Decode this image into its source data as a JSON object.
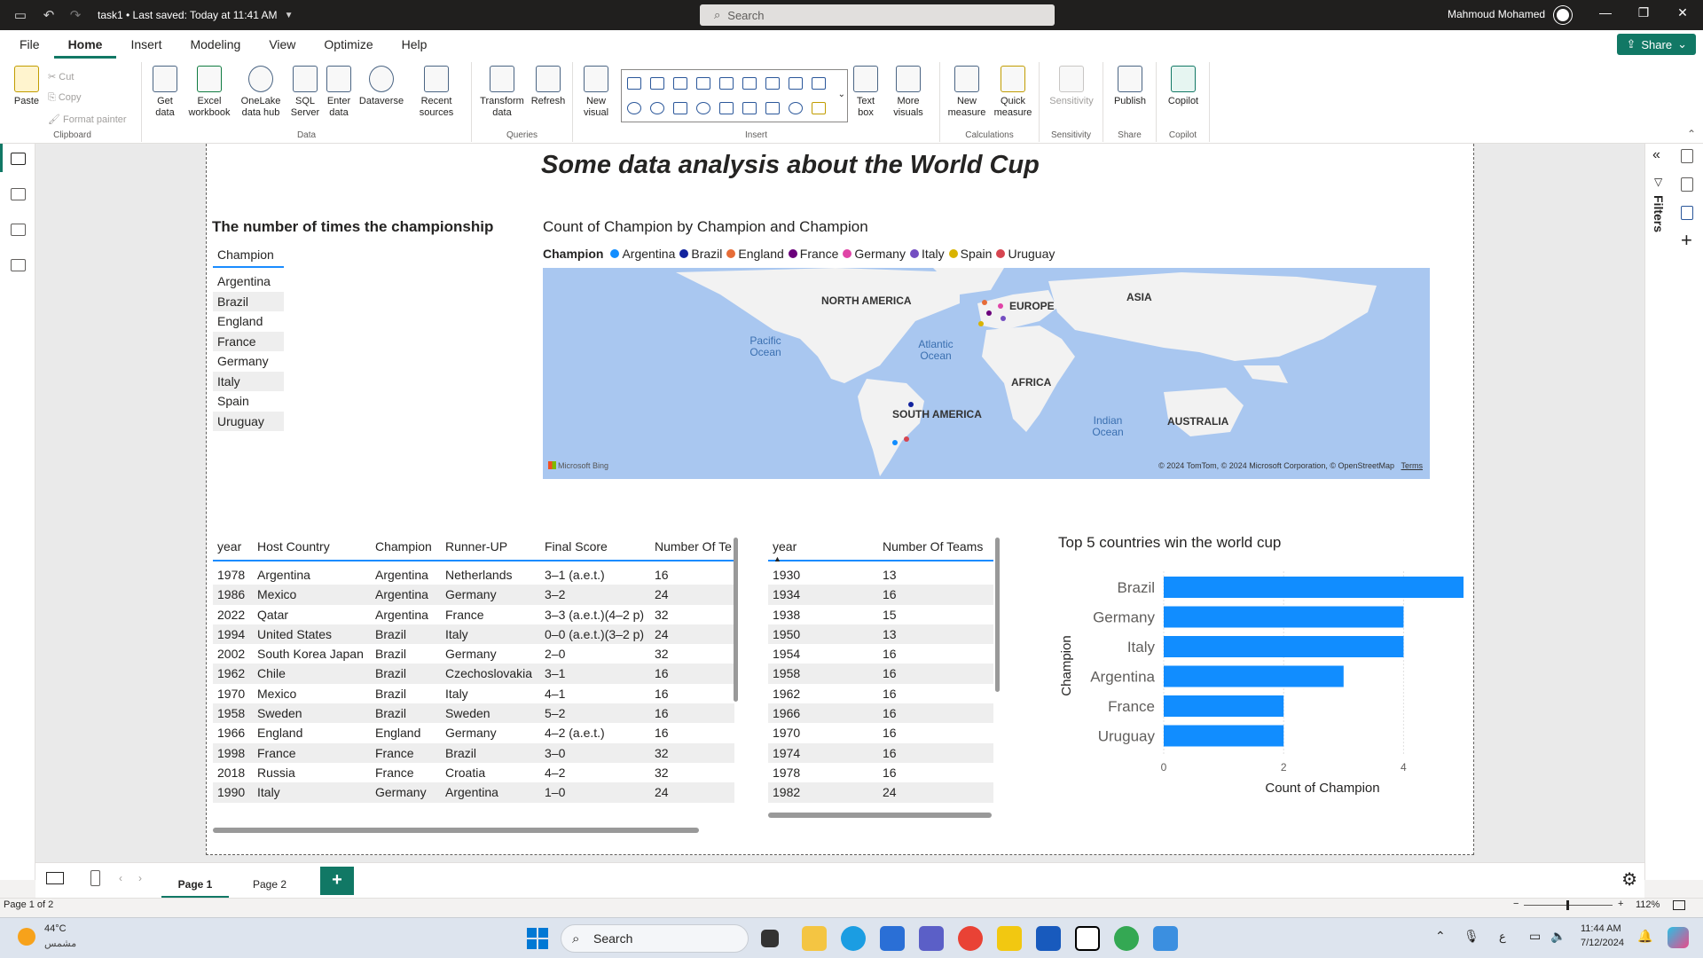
{
  "titlebar": {
    "doc_title": "task1 • Last saved: Today at 11:41 AM",
    "search_placeholder": "Search",
    "user": "Mahmoud Mohamed"
  },
  "menu": {
    "items": [
      "File",
      "Home",
      "Insert",
      "Modeling",
      "View",
      "Optimize",
      "Help"
    ],
    "active": "Home",
    "share": "Share"
  },
  "ribbon": {
    "clipboard": {
      "paste": "Paste",
      "cut": "Cut",
      "copy": "Copy",
      "format_painter": "Format painter",
      "label": "Clipboard"
    },
    "data": {
      "get_data": "Get data",
      "excel": "Excel workbook",
      "onelake": "OneLake data hub",
      "sql": "SQL Server",
      "enter": "Enter data",
      "dataverse": "Dataverse",
      "recent": "Recent sources",
      "label": "Data"
    },
    "queries": {
      "transform": "Transform data",
      "refresh": "Refresh",
      "label": "Queries"
    },
    "insert": {
      "new_visual": "New visual",
      "text_box": "Text box",
      "more_visuals": "More visuals",
      "label": "Insert"
    },
    "calculations": {
      "new_measure": "New measure",
      "quick_measure": "Quick measure",
      "label": "Calculations"
    },
    "sensitivity": {
      "btn": "Sensitivity",
      "label": "Sensitivity"
    },
    "share": {
      "publish": "Publish",
      "label": "Share"
    },
    "copilot": {
      "btn": "Copilot",
      "label": "Copilot"
    }
  },
  "report": {
    "title": "Some data analysis about the World Cup",
    "champ_table": {
      "title": "The number of times the championship",
      "header": "Champion",
      "rows": [
        "Argentina",
        "Brazil",
        "England",
        "France",
        "Germany",
        "Italy",
        "Spain",
        "Uruguay"
      ]
    },
    "map": {
      "title": "Count of Champion by Champion and Champion",
      "legend_title": "Champion",
      "legend": [
        {
          "name": "Argentina",
          "color": "#118dff"
        },
        {
          "name": "Brazil",
          "color": "#12239e"
        },
        {
          "name": "England",
          "color": "#e66c37"
        },
        {
          "name": "France",
          "color": "#6b007b"
        },
        {
          "name": "Germany",
          "color": "#e044a7"
        },
        {
          "name": "Italy",
          "color": "#744ec2"
        },
        {
          "name": "Spain",
          "color": "#d9b300"
        },
        {
          "name": "Uruguay",
          "color": "#d64550"
        }
      ],
      "labels": {
        "north_america": "NORTH AMERICA",
        "europe": "EUROPE",
        "asia": "ASIA",
        "pacific": "Pacific Ocean",
        "atlantic": "Atlantic Ocean",
        "africa": "AFRICA",
        "south_america": "SOUTH AMERICA",
        "indian": "Indian Ocean",
        "australia": "AUSTRALIA"
      },
      "bing": "Microsoft Bing",
      "copyright": "© 2024 TomTom, © 2024 Microsoft Corporation, © OpenStreetMap",
      "terms": "Terms"
    },
    "matches_table": {
      "columns": [
        "year",
        "Host Country",
        "Champion",
        "Runner-UP",
        "Final Score",
        "Number Of Te"
      ],
      "rows": [
        [
          "1978",
          "Argentina",
          "Argentina",
          "Netherlands",
          "3–1 (a.e.t.)",
          "16"
        ],
        [
          "1986",
          "Mexico",
          "Argentina",
          "Germany",
          "3–2",
          "24"
        ],
        [
          "2022",
          "Qatar",
          "Argentina",
          "France",
          "3–3 (a.e.t.)(4–2 p)",
          "32"
        ],
        [
          "1994",
          "United States",
          "Brazil",
          "Italy",
          "0–0 (a.e.t.)(3–2 p)",
          "24"
        ],
        [
          "2002",
          "South Korea Japan",
          "Brazil",
          "Germany",
          "2–0",
          "32"
        ],
        [
          "1962",
          "Chile",
          "Brazil",
          "Czechoslovakia",
          "3–1",
          "16"
        ],
        [
          "1970",
          "Mexico",
          "Brazil",
          "Italy",
          "4–1",
          "16"
        ],
        [
          "1958",
          "Sweden",
          "Brazil",
          "Sweden",
          "5–2",
          "16"
        ],
        [
          "1966",
          "England",
          "England",
          "Germany",
          "4–2 (a.e.t.)",
          "16"
        ],
        [
          "1998",
          "France",
          "France",
          "Brazil",
          "3–0",
          "32"
        ],
        [
          "2018",
          "Russia",
          "France",
          "Croatia",
          "4–2",
          "32"
        ],
        [
          "1990",
          "Italy",
          "Germany",
          "Argentina",
          "1–0",
          "24"
        ]
      ]
    },
    "teams_table": {
      "columns": [
        "year",
        "Number Of Teams"
      ],
      "rows": [
        [
          "1930",
          "13"
        ],
        [
          "1934",
          "16"
        ],
        [
          "1938",
          "15"
        ],
        [
          "1950",
          "13"
        ],
        [
          "1954",
          "16"
        ],
        [
          "1958",
          "16"
        ],
        [
          "1962",
          "16"
        ],
        [
          "1966",
          "16"
        ],
        [
          "1970",
          "16"
        ],
        [
          "1974",
          "16"
        ],
        [
          "1978",
          "16"
        ],
        [
          "1982",
          "24"
        ]
      ]
    },
    "bar_chart": {
      "title": "Top 5 countries win the world cup"
    }
  },
  "chart_data": {
    "type": "bar",
    "orientation": "horizontal",
    "title": "Top 5 countries win the world cup",
    "categories": [
      "Brazil",
      "Germany",
      "Italy",
      "Argentina",
      "France",
      "Uruguay"
    ],
    "values": [
      5,
      4,
      4,
      3,
      2,
      2
    ],
    "xlabel": "Count of Champion",
    "ylabel": "Champion",
    "xticks": [
      "0",
      "2",
      "4"
    ],
    "xlim": [
      0,
      5
    ],
    "color": "#118dff",
    "grid": true
  },
  "pages": {
    "tabs": [
      "Page 1",
      "Page 2"
    ],
    "active": "Page 1",
    "add": "+"
  },
  "status": {
    "page_info": "Page 1 of 2",
    "zoom": "112%"
  },
  "taskbar": {
    "weather_temp": "44°C",
    "weather_desc": "مشمس",
    "search": "Search",
    "time": "11:44 AM",
    "date": "7/12/2024",
    "lang": "ع"
  }
}
